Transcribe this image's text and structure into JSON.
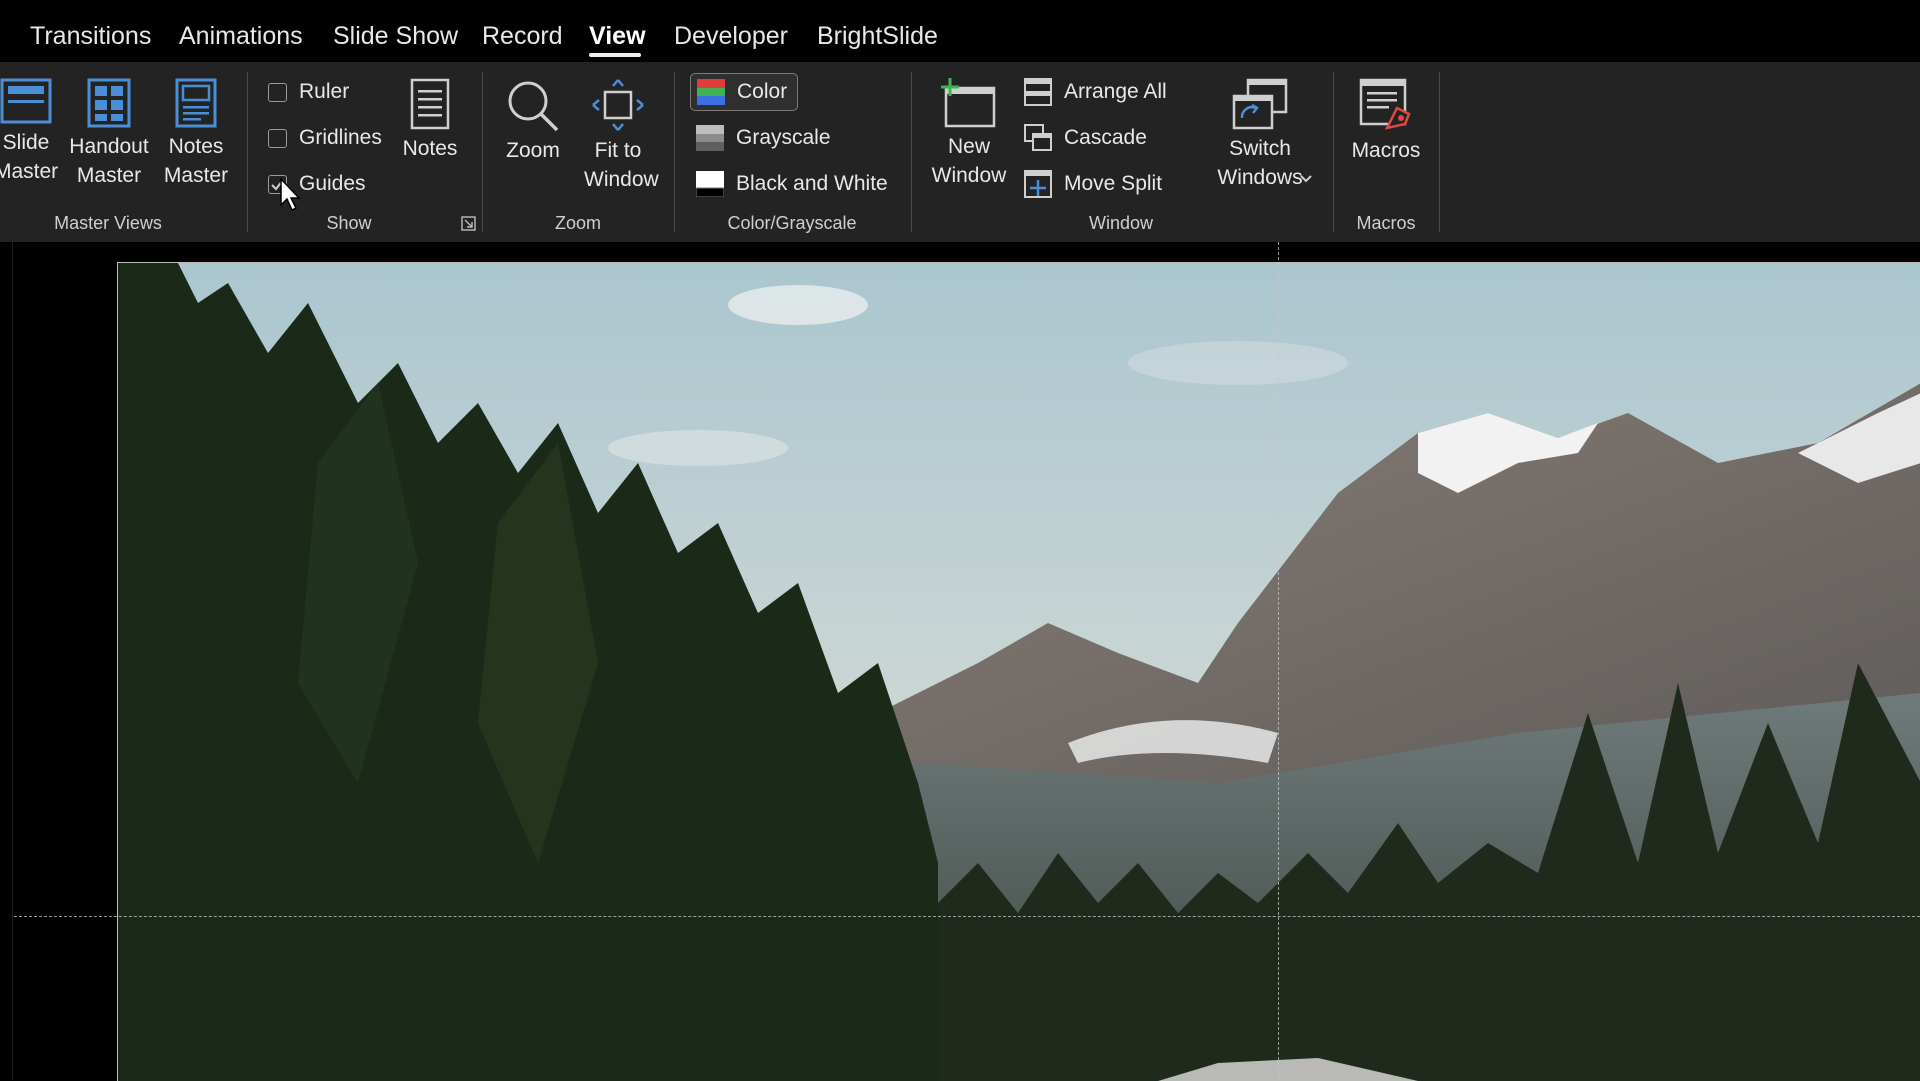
{
  "tabs": [
    "Transitions",
    "Animations",
    "Slide Show",
    "Record",
    "View",
    "Developer",
    "BrightSlide"
  ],
  "active_tab": "View",
  "groups": {
    "master_views": {
      "label": "Master Views",
      "slide_master": "Slide\nMaster",
      "handout_master": "Handout\nMaster",
      "notes_master": "Notes\nMaster"
    },
    "show": {
      "label": "Show",
      "ruler": {
        "label": "Ruler",
        "checked": false
      },
      "gridlines": {
        "label": "Gridlines",
        "checked": false
      },
      "guides": {
        "label": "Guides",
        "checked": true
      },
      "notes": "Notes"
    },
    "zoom": {
      "label": "Zoom",
      "zoom": "Zoom",
      "fit_to_window": "Fit to\nWindow"
    },
    "color_grayscale": {
      "label": "Color/Grayscale",
      "color": "Color",
      "grayscale": "Grayscale",
      "black_and_white": "Black and White"
    },
    "window": {
      "label": "Window",
      "new_window": "New\nWindow",
      "arrange_all": "Arrange All",
      "cascade": "Cascade",
      "move_split": "Move Split",
      "switch_windows": "Switch\nWindows"
    },
    "macros": {
      "label": "Macros",
      "macros": "Macros"
    }
  },
  "colors": {
    "ribbon_bg": "#232323",
    "tabbar_bg": "#000000",
    "icon_blue": "#4a8fd6",
    "sky": "#b7cfd4",
    "forest": "#1b2a18"
  }
}
